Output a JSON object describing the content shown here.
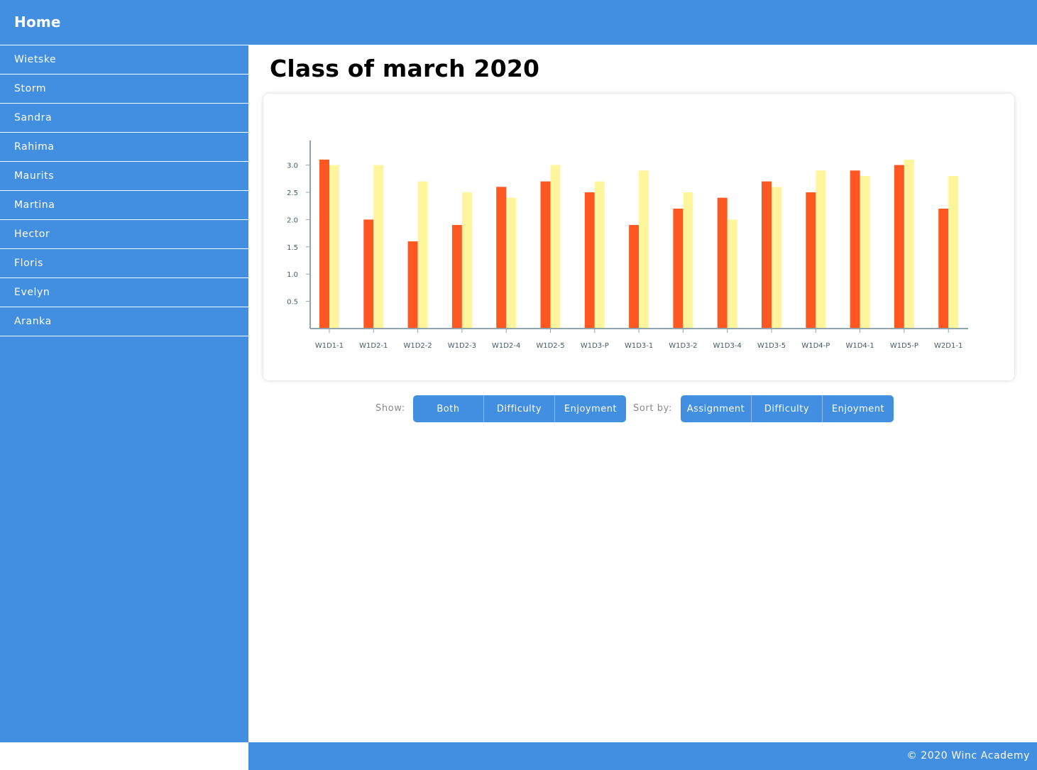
{
  "nav": {
    "home_label": "Home"
  },
  "sidebar": {
    "items": [
      {
        "label": "Wietske"
      },
      {
        "label": "Storm"
      },
      {
        "label": "Sandra"
      },
      {
        "label": "Rahima"
      },
      {
        "label": "Maurits"
      },
      {
        "label": "Martina"
      },
      {
        "label": "Hector"
      },
      {
        "label": "Floris"
      },
      {
        "label": "Evelyn"
      },
      {
        "label": "Aranka"
      }
    ]
  },
  "main": {
    "title": "Class of march 2020"
  },
  "controls": {
    "show_label": "Show:",
    "show_buttons": [
      "Both",
      "Difficulty",
      "Enjoyment"
    ],
    "sort_label": "Sort by:",
    "sort_buttons": [
      "Assignment",
      "Difficulty",
      "Enjoyment"
    ]
  },
  "footer": {
    "text": "© 2020 Winc Academy"
  },
  "colors": {
    "accent": "#428fe1",
    "difficulty": "#ff5722",
    "enjoyment": "#fff59d"
  },
  "chart_data": {
    "type": "bar",
    "categories": [
      "W1D1-1",
      "W1D2-1",
      "W1D2-2",
      "W1D2-3",
      "W1D2-4",
      "W1D2-5",
      "W1D3-P",
      "W1D3-1",
      "W1D3-2",
      "W1D3-4",
      "W1D3-5",
      "W1D4-P",
      "W1D4-1",
      "W1D5-P",
      "W2D1-1"
    ],
    "series": [
      {
        "values": [
          3.1,
          2.0,
          1.6,
          1.9,
          2.6,
          2.7,
          2.5,
          1.9,
          2.2,
          2.4,
          2.7,
          2.5,
          2.9,
          3.0,
          2.2
        ],
        "color": "#ff5722"
      },
      {
        "values": [
          3.0,
          3.0,
          2.7,
          2.5,
          2.4,
          3.0,
          2.7,
          2.9,
          2.5,
          2.0,
          2.6,
          2.9,
          2.8,
          3.1,
          2.8
        ],
        "color": "#fff59d"
      }
    ],
    "yticks": [
      "0.5",
      "1.0",
      "1.5",
      "2.0",
      "2.5",
      "3.0"
    ],
    "ylim": [
      0,
      3.45
    ],
    "grid": false,
    "legend": "none"
  }
}
